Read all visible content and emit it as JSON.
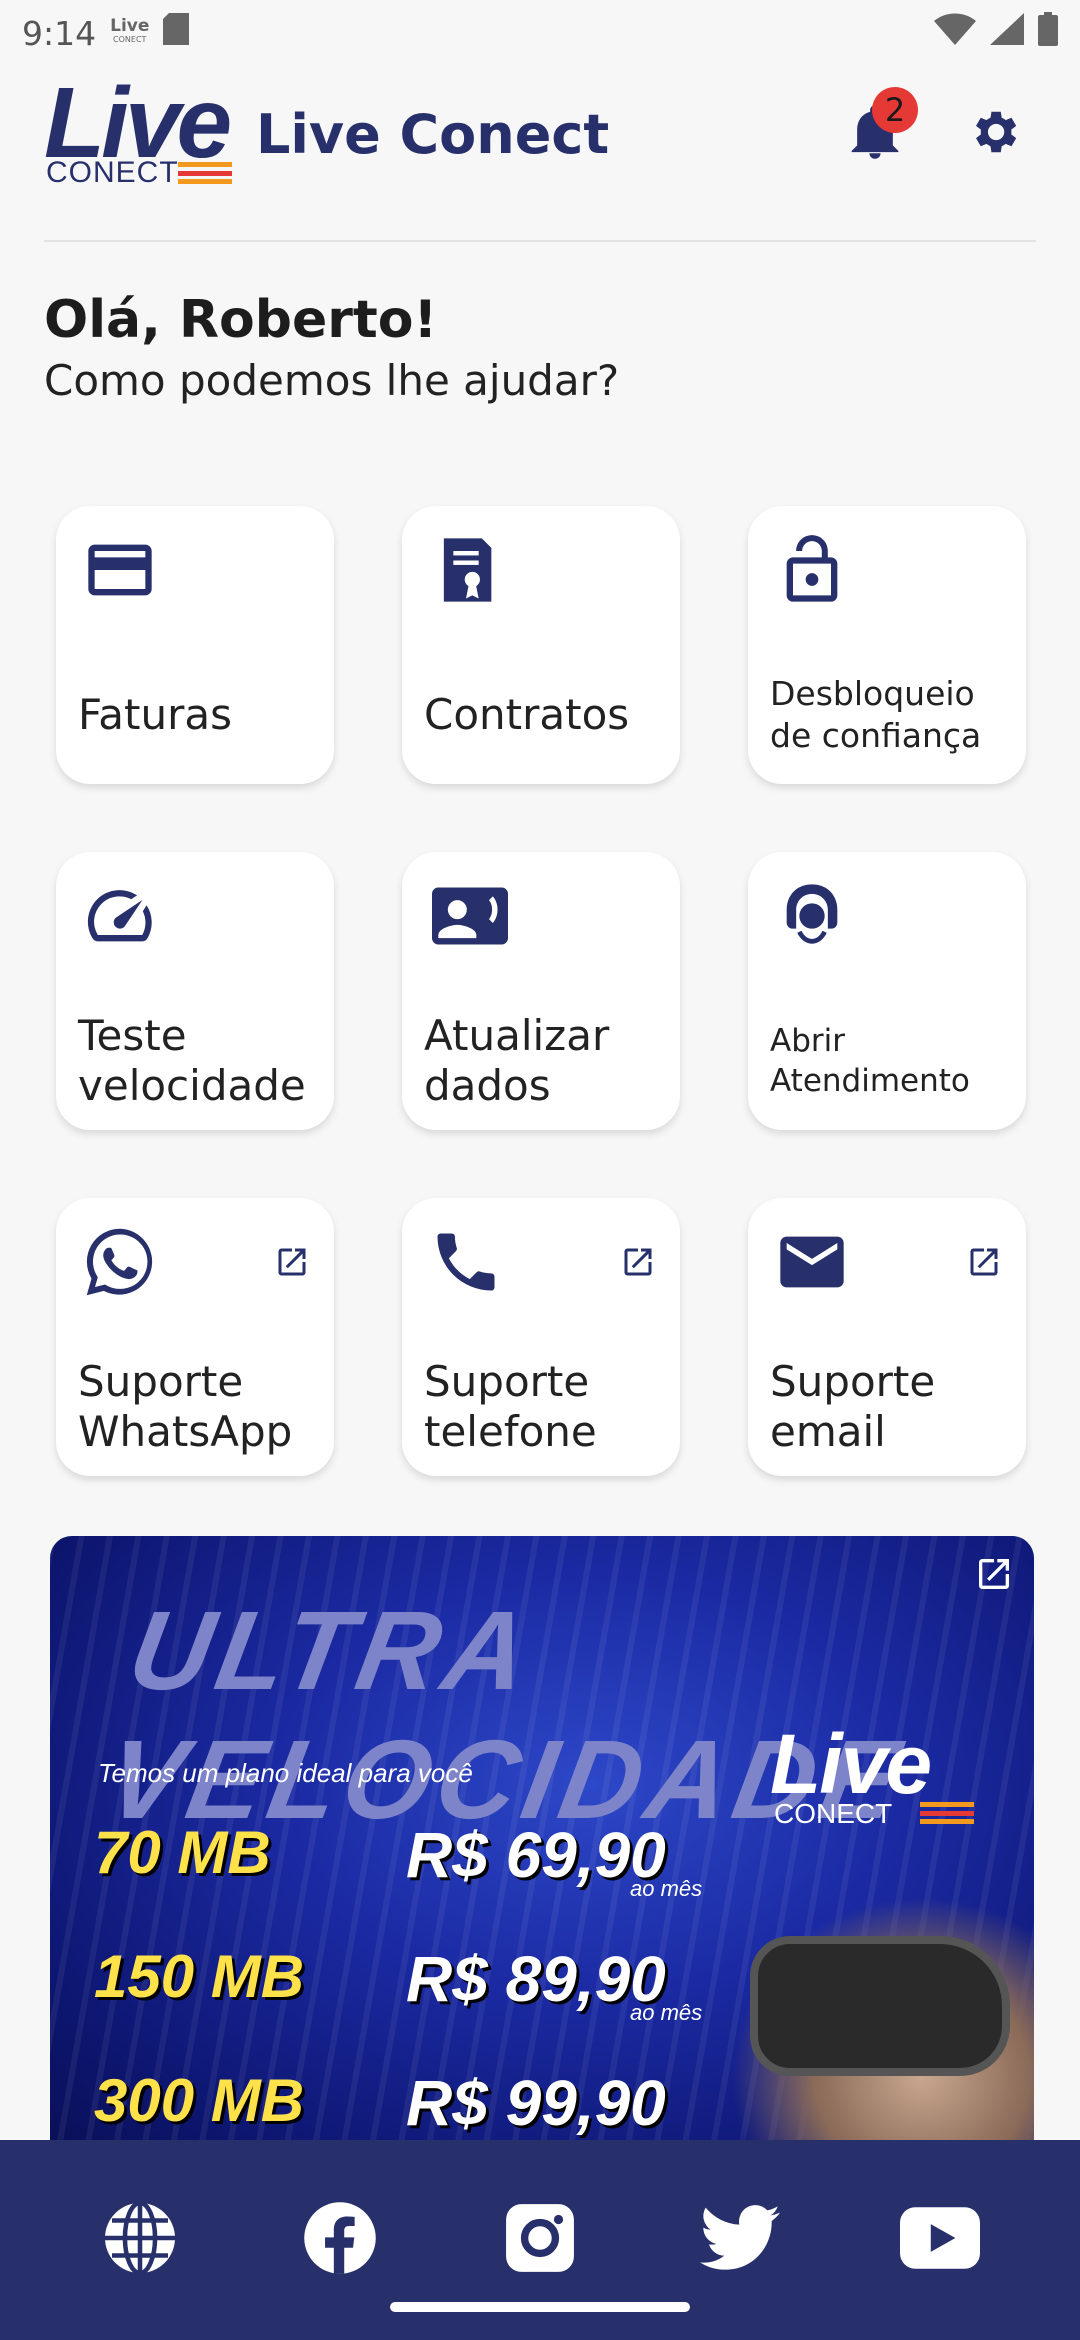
{
  "status_bar": {
    "time": "9:14",
    "mini_logo_main": "Live",
    "mini_logo_sub": "CONECT",
    "icons": [
      "sd-card-icon",
      "wifi-icon",
      "cell-signal-icon",
      "battery-icon"
    ]
  },
  "header": {
    "logo_main": "Live",
    "logo_sub": "CONECT",
    "title": "Live Conect",
    "notification_count": "2"
  },
  "greeting": {
    "title": "Olá, Roberto!",
    "subtitle": "Como podemos lhe ajudar?"
  },
  "menu": [
    {
      "label": "Faturas",
      "icon": "credit-card-icon",
      "external": false
    },
    {
      "label": "Contratos",
      "icon": "contract-icon",
      "external": false
    },
    {
      "label": "Desbloqueio de confiança",
      "icon": "unlock-icon",
      "external": false
    },
    {
      "label": "Teste velocidade",
      "icon": "speedometer-icon",
      "external": false
    },
    {
      "label": "Atualizar dados",
      "icon": "contact-card-icon",
      "external": false
    },
    {
      "label": "Abrir Atendimento",
      "icon": "support-agent-icon",
      "external": false
    },
    {
      "label": "Suporte WhatsApp",
      "icon": "whatsapp-icon",
      "external": true
    },
    {
      "label": "Suporte telefone",
      "icon": "phone-icon",
      "external": true
    },
    {
      "label": "Suporte email",
      "icon": "email-icon",
      "external": true
    }
  ],
  "banner": {
    "headline": "ULTRA VELOCIDADE",
    "tagline": "Temos um plano ideal para você",
    "logo_main": "Live",
    "logo_sub": "CONECT",
    "plans": [
      {
        "speed": "70 MB",
        "price": "R$ 69,90",
        "period": "ao mês"
      },
      {
        "speed": "150 MB",
        "price": "R$ 89,90",
        "period": "ao mês"
      },
      {
        "speed": "300 MB",
        "price": "R$ 99,90",
        "period": ""
      }
    ]
  },
  "social": [
    "globe-icon",
    "facebook-icon",
    "instagram-icon",
    "twitter-icon",
    "youtube-icon"
  ],
  "colors": {
    "brand_navy": "#27306b",
    "accent_orange": "#f39a1e",
    "accent_red": "#e53935",
    "badge": "#e53935",
    "background": "#f7f7f7"
  }
}
